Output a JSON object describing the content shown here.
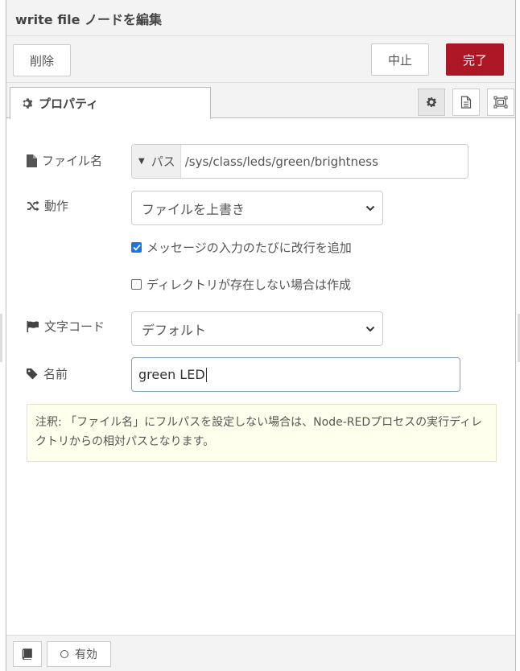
{
  "header": {
    "title": "write file ノードを編集"
  },
  "toolbar": {
    "delete_label": "削除",
    "cancel_label": "中止",
    "done_label": "完了"
  },
  "tabs": {
    "properties_label": "プロパティ"
  },
  "form": {
    "filename": {
      "label": "ファイル名",
      "type_label": "パス",
      "value": "/sys/class/leds/green/brightness"
    },
    "action": {
      "label": "動作",
      "selected": "ファイルを上書き"
    },
    "append_newline": {
      "label": "メッセージの入力のたびに改行を追加",
      "checked": true
    },
    "create_dir": {
      "label": "ディレクトリが存在しない場合は作成",
      "checked": false
    },
    "encoding": {
      "label": "文字コード",
      "selected": "デフォルト"
    },
    "name": {
      "label": "名前",
      "value": "green LED"
    }
  },
  "tip": {
    "text": "注釈: 「ファイル名」にフルパスを設定しない場合は、Node-REDプロセスの実行ディレクトリからの相対パスとなります。"
  },
  "footer": {
    "enabled_label": "有効"
  },
  "colors": {
    "primary": "#ad1625",
    "checkbox": "#1a73e8",
    "tip_bg": "#ffffee"
  }
}
